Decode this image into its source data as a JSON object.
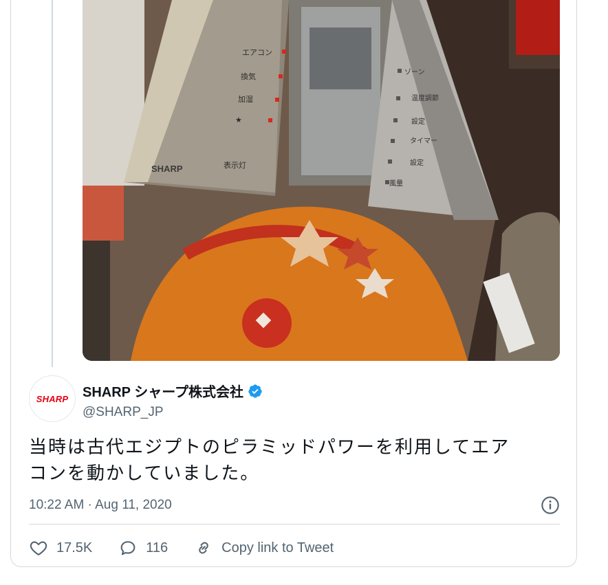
{
  "author": {
    "display_name": "SHARP シャープ株式会社",
    "handle": "@SHARP_JP",
    "avatar_text": "SHARP",
    "verified": true
  },
  "tweet": {
    "text_line1": "当時は古代エジプトのピラミッドパワーを利用してエア",
    "text_line2": "コンを動かしていました。",
    "timestamp": "10:22 AM · Aug 11, 2020"
  },
  "actions": {
    "likes": "17.5K",
    "replies": "116",
    "copy_link_label": "Copy link to Tweet"
  },
  "media": {
    "device_brand": "SHARP",
    "left_panel_labels": [
      "エアコン",
      "換気",
      "加湿",
      "★",
      "表示灯"
    ],
    "right_panel_labels": [
      "ゾーン",
      "温度調節",
      "設定",
      "タイマー",
      "設定",
      "風量"
    ]
  },
  "colors": {
    "verified_blue": "#1d9bf0",
    "secondary_text": "#536471",
    "border": "#cfd9de",
    "brand_red": "#e60012"
  }
}
